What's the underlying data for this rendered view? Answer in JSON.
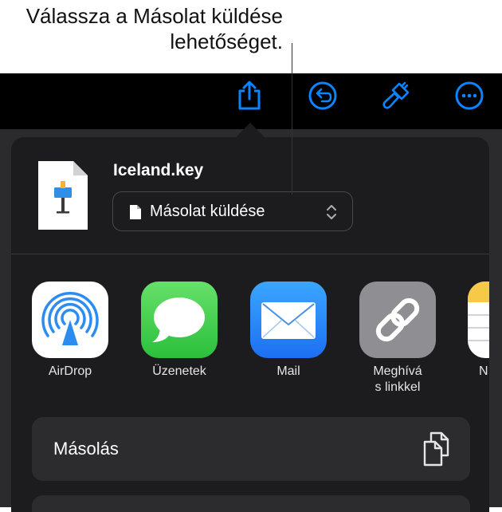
{
  "callout": {
    "text": "Válassza a Másolat küldése lehetőséget."
  },
  "toolbar": {
    "icons": [
      "share-icon",
      "undo-icon",
      "paintbrush-icon",
      "more-icon"
    ],
    "accent_color": "#0a84ff"
  },
  "sheet": {
    "file_name": "Iceland.key",
    "send_option": "Másolat küldése",
    "apps": [
      {
        "label": "AirDrop",
        "icon": "airdrop-icon"
      },
      {
        "label": "Üzenetek",
        "icon": "messages-icon"
      },
      {
        "label": "Mail",
        "icon": "mail-icon"
      },
      {
        "label": "Meghívás linkkel",
        "label_line1": "Meghívá",
        "label_line2": "s linkkel",
        "icon": "link-icon"
      },
      {
        "label": "N",
        "icon": "notes-icon"
      }
    ],
    "actions": [
      {
        "label": "Másolás",
        "icon": "copy-icon"
      }
    ]
  }
}
